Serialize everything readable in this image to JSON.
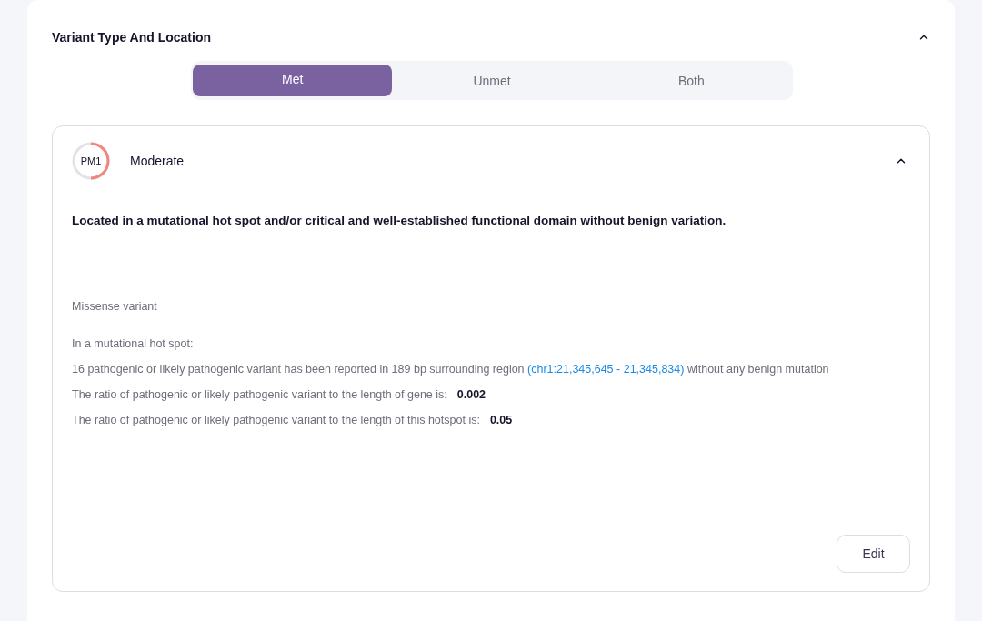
{
  "section": {
    "title": "Variant Type And Location",
    "expanded": true
  },
  "filter_tabs": [
    {
      "label": "Met",
      "selected": true
    },
    {
      "label": "Unmet",
      "selected": false
    },
    {
      "label": "Both",
      "selected": false
    }
  ],
  "criterion": {
    "code": "PM1",
    "level": 0.5,
    "strength": "Moderate",
    "expanded": true,
    "description": "Located in a mutational hot spot and/or critical and well-established functional domain without benign variation.",
    "variant_type": "Missense variant",
    "hotspot_heading": "In a mutational hot spot:",
    "hotspot_summary": {
      "before": "16 pathogenic or likely pathogenic variant has been reported in 189 bp surrounding region",
      "link": "(chr1:21,345,645 - 21,345,834)",
      "after": "without any benign mutation"
    },
    "ratios": [
      {
        "label": "The ratio of pathogenic or likely pathogenic variant to the length of gene is:",
        "value": "0.002"
      },
      {
        "label": "The ratio of pathogenic or likely pathogenic variant to the length of this hotspot is:",
        "value": "0.05"
      }
    ],
    "edit_button": "Edit"
  }
}
